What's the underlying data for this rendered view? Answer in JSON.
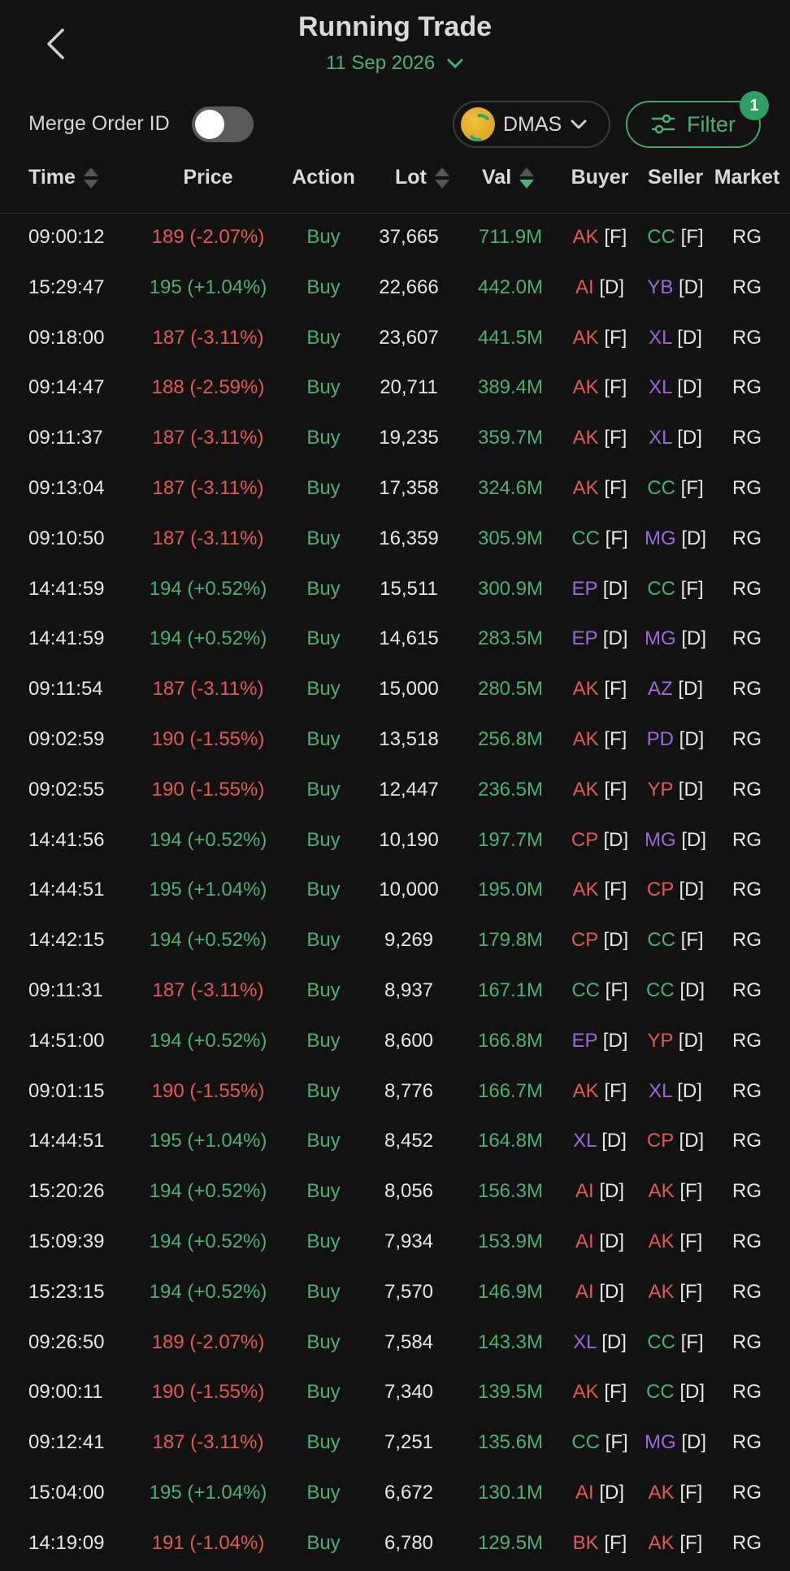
{
  "header": {
    "title": "Running Trade",
    "date": "11 Sep 2026"
  },
  "controls": {
    "merge_label": "Merge Order ID",
    "merge_enabled": false,
    "stock": "DMAS",
    "filter_label": "Filter",
    "filter_count": "1"
  },
  "columns": {
    "time": "Time",
    "price": "Price",
    "action": "Action",
    "lot": "Lot",
    "val": "Val",
    "buyer": "Buyer",
    "seller": "Seller",
    "market": "Market"
  },
  "colors": {
    "up": "#4caf76",
    "down": "#e05a52",
    "broker_f": "#e05a52",
    "broker_cc": "#4caf76",
    "broker_d": "#9a69d8",
    "accent": "#4caf76",
    "background": "#121212"
  },
  "rows": [
    {
      "time": "09:00:12",
      "price": "189 (-2.07%)",
      "dir": "down",
      "action": "Buy",
      "lot": "37,665",
      "val": "711.9M",
      "buyer": "AK",
      "buyer_type": "[F]",
      "buyer_color": "red",
      "seller": "CC",
      "seller_type": "[F]",
      "seller_color": "green",
      "market": "RG"
    },
    {
      "time": "15:29:47",
      "price": "195 (+1.04%)",
      "dir": "up",
      "action": "Buy",
      "lot": "22,666",
      "val": "442.0M",
      "buyer": "AI",
      "buyer_type": "[D]",
      "buyer_color": "red",
      "seller": "YB",
      "seller_type": "[D]",
      "seller_color": "purple",
      "market": "RG"
    },
    {
      "time": "09:18:00",
      "price": "187 (-3.11%)",
      "dir": "down",
      "action": "Buy",
      "lot": "23,607",
      "val": "441.5M",
      "buyer": "AK",
      "buyer_type": "[F]",
      "buyer_color": "red",
      "seller": "XL",
      "seller_type": "[D]",
      "seller_color": "purple",
      "market": "RG"
    },
    {
      "time": "09:14:47",
      "price": "188 (-2.59%)",
      "dir": "down",
      "action": "Buy",
      "lot": "20,711",
      "val": "389.4M",
      "buyer": "AK",
      "buyer_type": "[F]",
      "buyer_color": "red",
      "seller": "XL",
      "seller_type": "[D]",
      "seller_color": "purple",
      "market": "RG"
    },
    {
      "time": "09:11:37",
      "price": "187 (-3.11%)",
      "dir": "down",
      "action": "Buy",
      "lot": "19,235",
      "val": "359.7M",
      "buyer": "AK",
      "buyer_type": "[F]",
      "buyer_color": "red",
      "seller": "XL",
      "seller_type": "[D]",
      "seller_color": "purple",
      "market": "RG"
    },
    {
      "time": "09:13:04",
      "price": "187 (-3.11%)",
      "dir": "down",
      "action": "Buy",
      "lot": "17,358",
      "val": "324.6M",
      "buyer": "AK",
      "buyer_type": "[F]",
      "buyer_color": "red",
      "seller": "CC",
      "seller_type": "[F]",
      "seller_color": "green",
      "market": "RG"
    },
    {
      "time": "09:10:50",
      "price": "187 (-3.11%)",
      "dir": "down",
      "action": "Buy",
      "lot": "16,359",
      "val": "305.9M",
      "buyer": "CC",
      "buyer_type": "[F]",
      "buyer_color": "green",
      "seller": "MG",
      "seller_type": "[D]",
      "seller_color": "purple",
      "market": "RG"
    },
    {
      "time": "14:41:59",
      "price": "194 (+0.52%)",
      "dir": "up",
      "action": "Buy",
      "lot": "15,511",
      "val": "300.9M",
      "buyer": "EP",
      "buyer_type": "[D]",
      "buyer_color": "purple",
      "seller": "CC",
      "seller_type": "[F]",
      "seller_color": "green",
      "market": "RG"
    },
    {
      "time": "14:41:59",
      "price": "194 (+0.52%)",
      "dir": "up",
      "action": "Buy",
      "lot": "14,615",
      "val": "283.5M",
      "buyer": "EP",
      "buyer_type": "[D]",
      "buyer_color": "purple",
      "seller": "MG",
      "seller_type": "[D]",
      "seller_color": "purple",
      "market": "RG"
    },
    {
      "time": "09:11:54",
      "price": "187 (-3.11%)",
      "dir": "down",
      "action": "Buy",
      "lot": "15,000",
      "val": "280.5M",
      "buyer": "AK",
      "buyer_type": "[F]",
      "buyer_color": "red",
      "seller": "AZ",
      "seller_type": "[D]",
      "seller_color": "purple",
      "market": "RG"
    },
    {
      "time": "09:02:59",
      "price": "190 (-1.55%)",
      "dir": "down",
      "action": "Buy",
      "lot": "13,518",
      "val": "256.8M",
      "buyer": "AK",
      "buyer_type": "[F]",
      "buyer_color": "red",
      "seller": "PD",
      "seller_type": "[D]",
      "seller_color": "purple",
      "market": "RG"
    },
    {
      "time": "09:02:55",
      "price": "190 (-1.55%)",
      "dir": "down",
      "action": "Buy",
      "lot": "12,447",
      "val": "236.5M",
      "buyer": "AK",
      "buyer_type": "[F]",
      "buyer_color": "red",
      "seller": "YP",
      "seller_type": "[D]",
      "seller_color": "red",
      "market": "RG"
    },
    {
      "time": "14:41:56",
      "price": "194 (+0.52%)",
      "dir": "up",
      "action": "Buy",
      "lot": "10,190",
      "val": "197.7M",
      "buyer": "CP",
      "buyer_type": "[D]",
      "buyer_color": "red",
      "seller": "MG",
      "seller_type": "[D]",
      "seller_color": "purple",
      "market": "RG"
    },
    {
      "time": "14:44:51",
      "price": "195 (+1.04%)",
      "dir": "up",
      "action": "Buy",
      "lot": "10,000",
      "val": "195.0M",
      "buyer": "AK",
      "buyer_type": "[F]",
      "buyer_color": "red",
      "seller": "CP",
      "seller_type": "[D]",
      "seller_color": "red",
      "market": "RG"
    },
    {
      "time": "14:42:15",
      "price": "194 (+0.52%)",
      "dir": "up",
      "action": "Buy",
      "lot": "9,269",
      "val": "179.8M",
      "buyer": "CP",
      "buyer_type": "[D]",
      "buyer_color": "red",
      "seller": "CC",
      "seller_type": "[F]",
      "seller_color": "green",
      "market": "RG"
    },
    {
      "time": "09:11:31",
      "price": "187 (-3.11%)",
      "dir": "down",
      "action": "Buy",
      "lot": "8,937",
      "val": "167.1M",
      "buyer": "CC",
      "buyer_type": "[F]",
      "buyer_color": "green",
      "seller": "CC",
      "seller_type": "[D]",
      "seller_color": "green",
      "market": "RG"
    },
    {
      "time": "14:51:00",
      "price": "194 (+0.52%)",
      "dir": "up",
      "action": "Buy",
      "lot": "8,600",
      "val": "166.8M",
      "buyer": "EP",
      "buyer_type": "[D]",
      "buyer_color": "purple",
      "seller": "YP",
      "seller_type": "[D]",
      "seller_color": "red",
      "market": "RG"
    },
    {
      "time": "09:01:15",
      "price": "190 (-1.55%)",
      "dir": "down",
      "action": "Buy",
      "lot": "8,776",
      "val": "166.7M",
      "buyer": "AK",
      "buyer_type": "[F]",
      "buyer_color": "red",
      "seller": "XL",
      "seller_type": "[D]",
      "seller_color": "purple",
      "market": "RG"
    },
    {
      "time": "14:44:51",
      "price": "195 (+1.04%)",
      "dir": "up",
      "action": "Buy",
      "lot": "8,452",
      "val": "164.8M",
      "buyer": "XL",
      "buyer_type": "[D]",
      "buyer_color": "purple",
      "seller": "CP",
      "seller_type": "[D]",
      "seller_color": "red",
      "market": "RG"
    },
    {
      "time": "15:20:26",
      "price": "194 (+0.52%)",
      "dir": "up",
      "action": "Buy",
      "lot": "8,056",
      "val": "156.3M",
      "buyer": "AI",
      "buyer_type": "[D]",
      "buyer_color": "red",
      "seller": "AK",
      "seller_type": "[F]",
      "seller_color": "red",
      "market": "RG"
    },
    {
      "time": "15:09:39",
      "price": "194 (+0.52%)",
      "dir": "up",
      "action": "Buy",
      "lot": "7,934",
      "val": "153.9M",
      "buyer": "AI",
      "buyer_type": "[D]",
      "buyer_color": "red",
      "seller": "AK",
      "seller_type": "[F]",
      "seller_color": "red",
      "market": "RG"
    },
    {
      "time": "15:23:15",
      "price": "194 (+0.52%)",
      "dir": "up",
      "action": "Buy",
      "lot": "7,570",
      "val": "146.9M",
      "buyer": "AI",
      "buyer_type": "[D]",
      "buyer_color": "red",
      "seller": "AK",
      "seller_type": "[F]",
      "seller_color": "red",
      "market": "RG"
    },
    {
      "time": "09:26:50",
      "price": "189 (-2.07%)",
      "dir": "down",
      "action": "Buy",
      "lot": "7,584",
      "val": "143.3M",
      "buyer": "XL",
      "buyer_type": "[D]",
      "buyer_color": "purple",
      "seller": "CC",
      "seller_type": "[F]",
      "seller_color": "green",
      "market": "RG"
    },
    {
      "time": "09:00:11",
      "price": "190 (-1.55%)",
      "dir": "down",
      "action": "Buy",
      "lot": "7,340",
      "val": "139.5M",
      "buyer": "AK",
      "buyer_type": "[F]",
      "buyer_color": "red",
      "seller": "CC",
      "seller_type": "[D]",
      "seller_color": "green",
      "market": "RG"
    },
    {
      "time": "09:12:41",
      "price": "187 (-3.11%)",
      "dir": "down",
      "action": "Buy",
      "lot": "7,251",
      "val": "135.6M",
      "buyer": "CC",
      "buyer_type": "[F]",
      "buyer_color": "green",
      "seller": "MG",
      "seller_type": "[D]",
      "seller_color": "purple",
      "market": "RG"
    },
    {
      "time": "15:04:00",
      "price": "195 (+1.04%)",
      "dir": "up",
      "action": "Buy",
      "lot": "6,672",
      "val": "130.1M",
      "buyer": "AI",
      "buyer_type": "[D]",
      "buyer_color": "red",
      "seller": "AK",
      "seller_type": "[F]",
      "seller_color": "red",
      "market": "RG"
    },
    {
      "time": "14:19:09",
      "price": "191 (-1.04%)",
      "dir": "down",
      "action": "Buy",
      "lot": "6,780",
      "val": "129.5M",
      "buyer": "BK",
      "buyer_type": "[F]",
      "buyer_color": "red",
      "seller": "AK",
      "seller_type": "[F]",
      "seller_color": "red",
      "market": "RG"
    }
  ]
}
